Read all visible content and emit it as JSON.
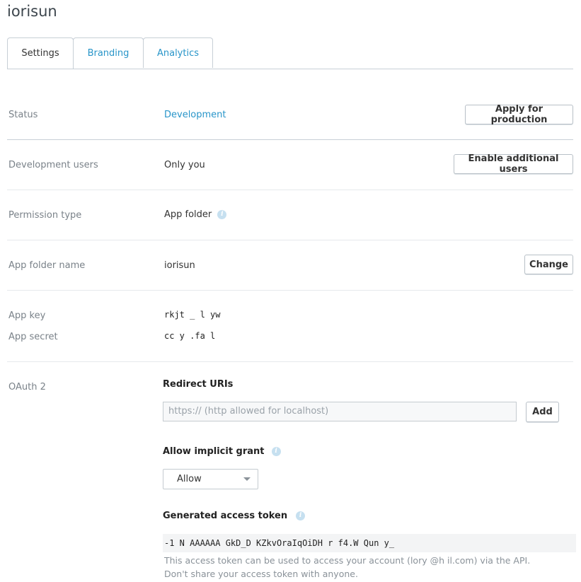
{
  "app": {
    "title": "iorisun"
  },
  "tabs": [
    {
      "label": "Settings",
      "active": true
    },
    {
      "label": "Branding",
      "active": false
    },
    {
      "label": "Analytics",
      "active": false
    }
  ],
  "settings": {
    "status": {
      "label": "Status",
      "value": "Development",
      "button": "Apply for production"
    },
    "dev_users": {
      "label": "Development users",
      "value": "Only you",
      "button": "Enable additional users"
    },
    "permission": {
      "label": "Permission type",
      "value": "App folder",
      "icon": "info-icon"
    },
    "folder": {
      "label": "App folder name",
      "value": "iorisun",
      "button": "Change"
    },
    "keys": {
      "key_label": "App key",
      "key_value": "rkjt  _     l    yw",
      "secret_label": "App secret",
      "secret_value": "cc   y  .fa      l"
    },
    "oauth": {
      "label": "OAuth 2",
      "redirect_heading": "Redirect URIs",
      "redirect_placeholder": "https:// (http allowed for localhost)",
      "add_button": "Add",
      "implicit_heading": "Allow implicit grant",
      "implicit_value": "Allow",
      "token_heading": "Generated access token",
      "token_value": "-1  N        AAAAAA      GkD_D        KZkvOraIqOiDH       r  f4.W      Qun     y_",
      "hint_line1": "This access token can be used to access your account (lory          @h     il.com) via the API.",
      "hint_line2": "Don't share your access token with anyone."
    }
  },
  "colors": {
    "link": "#2895c9",
    "border": "#c7cfd6",
    "muted": "#7a8289"
  }
}
